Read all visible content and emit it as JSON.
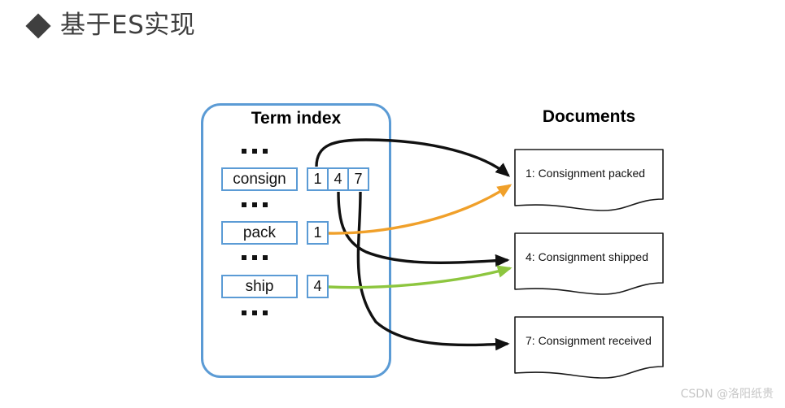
{
  "slide": {
    "bullet_icon": "diamond-bullet-icon",
    "title": "基于ES实现"
  },
  "diagram": {
    "term_index": {
      "heading": "Term index",
      "panel_border_color": "#5b9bd5",
      "rows": [
        {
          "kind": "ellipsis",
          "text": "..."
        },
        {
          "kind": "term",
          "term": "consign",
          "postings": [
            "1",
            "4",
            "7"
          ]
        },
        {
          "kind": "ellipsis",
          "text": "..."
        },
        {
          "kind": "term",
          "term": "pack",
          "postings": [
            "1"
          ]
        },
        {
          "kind": "ellipsis",
          "text": "..."
        },
        {
          "kind": "term",
          "term": "ship",
          "postings": [
            "4"
          ]
        },
        {
          "kind": "ellipsis",
          "text": "..."
        }
      ]
    },
    "documents": {
      "heading": "Documents",
      "items": [
        {
          "id": "1",
          "label": "1: Consignment packed"
        },
        {
          "id": "4",
          "label": "4: Consignment shipped"
        },
        {
          "id": "7",
          "label": "7: Consignment received"
        }
      ]
    },
    "connections": [
      {
        "name": "consign-1-to-doc1",
        "from": "consign:1",
        "to": "doc:1",
        "color": "#111111"
      },
      {
        "name": "consign-4-to-doc4",
        "from": "consign:4",
        "to": "doc:4",
        "color": "#111111"
      },
      {
        "name": "consign-7-to-doc7",
        "from": "consign:7",
        "to": "doc:7",
        "color": "#111111"
      },
      {
        "name": "pack-1-to-doc1",
        "from": "pack:1",
        "to": "doc:1",
        "color": "#f0a02a"
      },
      {
        "name": "ship-4-to-doc4",
        "from": "ship:4",
        "to": "doc:4",
        "color": "#8dc63f"
      }
    ],
    "colors": {
      "panel_blue": "#5b9bd5",
      "box_blue": "#5b9bd5",
      "black_arrow": "#111111",
      "orange_arrow": "#f0a02a",
      "green_arrow": "#8dc63f",
      "title_gray": "#3f3f3f"
    }
  },
  "watermark": {
    "text": "CSDN @洛阳纸贵"
  }
}
